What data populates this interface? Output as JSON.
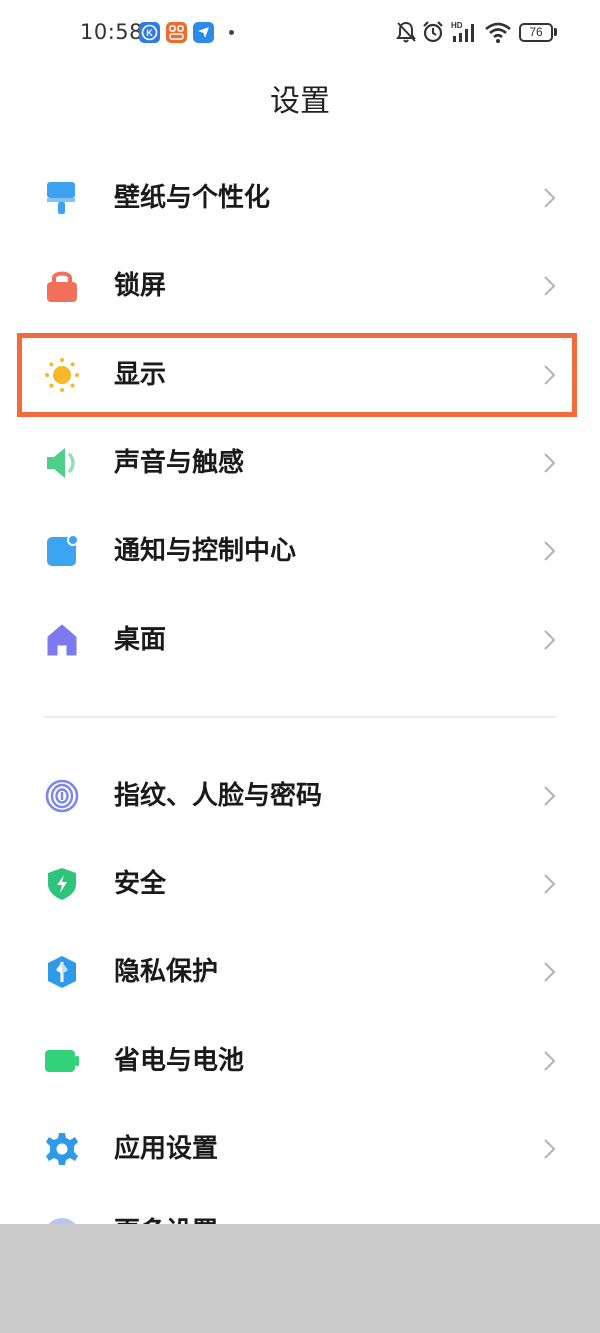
{
  "status_bar": {
    "time": "10:58",
    "battery": "76",
    "icons": [
      "bell-off-icon",
      "alarm-icon",
      "hd-signal-icon",
      "wifi-icon",
      "battery-icon"
    ],
    "app_icons": [
      {
        "name": "k-app-icon",
        "letter": "K",
        "color": "#2f7ae5"
      },
      {
        "name": "orange-app-icon",
        "letter": "",
        "color": "#f06b2a"
      },
      {
        "name": "send-app-icon",
        "letter": "",
        "color": "#2a8be8"
      }
    ]
  },
  "header": {
    "title": "设置"
  },
  "settings": {
    "group1": [
      {
        "label": "壁纸与个性化",
        "icon": "paint-roller-icon",
        "color": "#3ea2f0"
      },
      {
        "label": "锁屏",
        "icon": "lock-icon",
        "color": "#f2705a"
      },
      {
        "label": "显示",
        "icon": "sun-icon",
        "color": "#f7b827"
      },
      {
        "label": "声音与触感",
        "icon": "speaker-icon",
        "color": "#4cd089"
      },
      {
        "label": "通知与控制中心",
        "icon": "notification-icon",
        "color": "#3da4f2"
      },
      {
        "label": "桌面",
        "icon": "home-icon",
        "color": "#7d7af0"
      }
    ],
    "group2": [
      {
        "label": "指纹、人脸与密码",
        "icon": "fingerprint-icon",
        "color": "#7d86ee"
      },
      {
        "label": "安全",
        "icon": "shield-icon",
        "color": "#2ec47c"
      },
      {
        "label": "隐私保护",
        "icon": "privacy-icon",
        "color": "#2f9be8"
      },
      {
        "label": "省电与电池",
        "icon": "battery-icon",
        "color": "#33d17a"
      },
      {
        "label": "应用设置",
        "icon": "gear-icon",
        "color": "#2f9be8"
      }
    ],
    "partial": {
      "label": "更多设置"
    }
  },
  "highlight": {
    "target": "显示",
    "color": "#f26b3a"
  }
}
